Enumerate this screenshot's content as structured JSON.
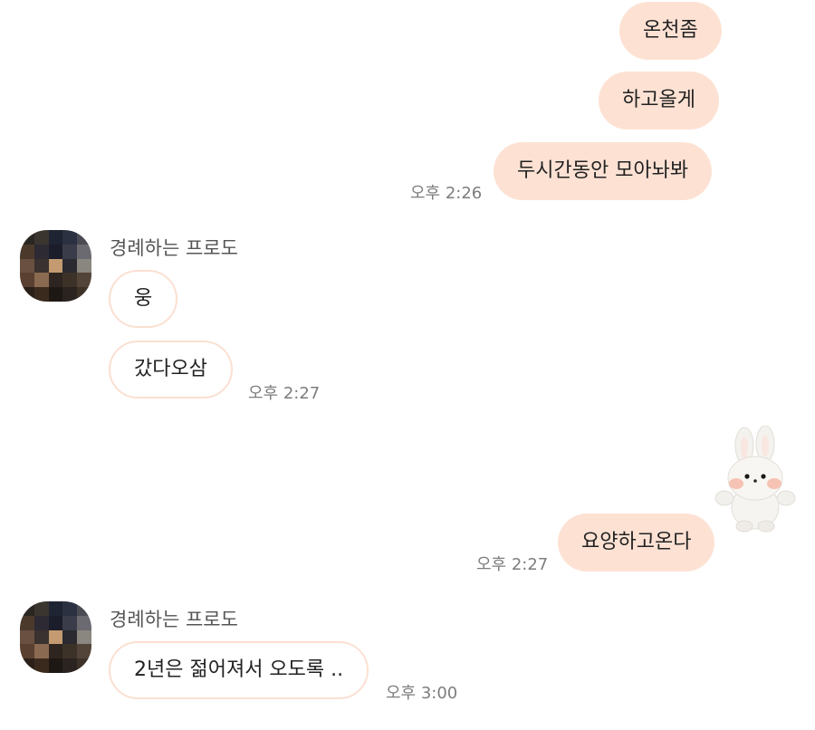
{
  "contact": {
    "name": "경례하는 프로도"
  },
  "messages": [
    {
      "sender": "me",
      "text": "온천좀"
    },
    {
      "sender": "me",
      "text": "하고올게"
    },
    {
      "sender": "me",
      "text": "두시간동안 모아놔봐",
      "time": "오후 2:26"
    },
    {
      "sender": "them",
      "text": "웅"
    },
    {
      "sender": "them",
      "text": "갔다오삼",
      "time": "오후 2:27"
    },
    {
      "sender": "me",
      "type": "sticker",
      "sticker": "white-rabbit-plush"
    },
    {
      "sender": "me",
      "text": "요양하고온다",
      "time": "오후 2:27"
    },
    {
      "sender": "them",
      "text": "2년은 젊어져서 오도록 ..",
      "time": "오후 3:00"
    }
  ],
  "colors": {
    "outgoing_bubble": "#fde2d4",
    "incoming_border": "#fbe0d2",
    "timestamp": "#7d7d7d"
  }
}
